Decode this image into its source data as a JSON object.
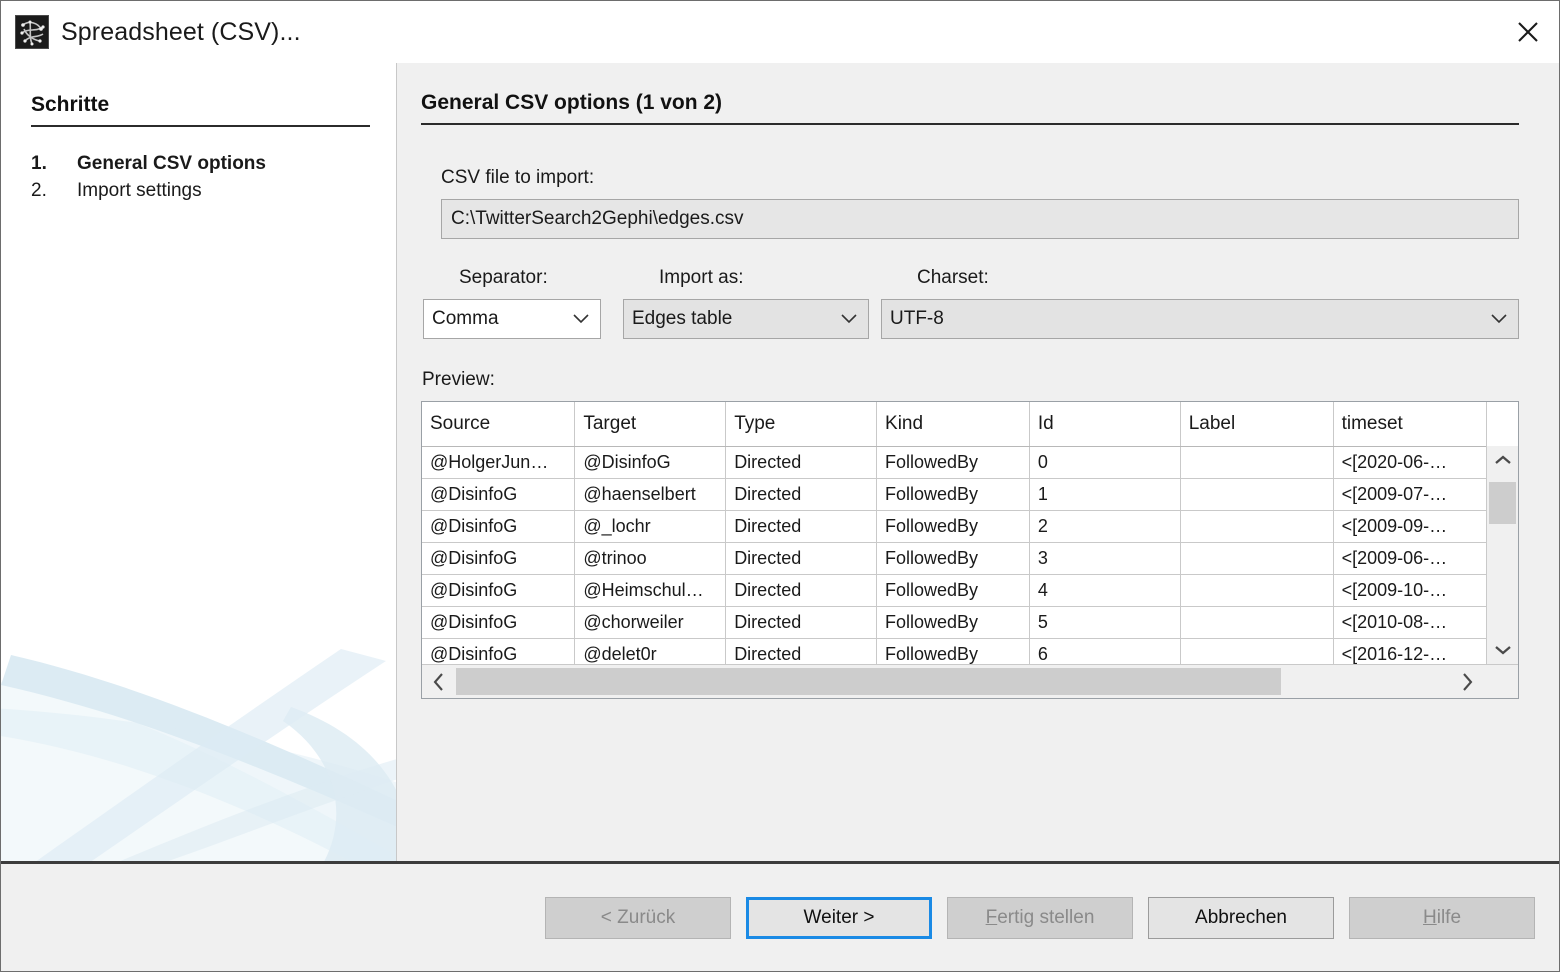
{
  "window": {
    "title": "Spreadsheet (CSV)...",
    "icon": "gephi-graph-icon",
    "close_label": "close-icon"
  },
  "sidebar": {
    "heading": "Schritte",
    "steps": [
      {
        "num": "1.",
        "label": "General CSV options",
        "current": true
      },
      {
        "num": "2.",
        "label": "Import settings",
        "current": false
      }
    ]
  },
  "main": {
    "title": "General CSV options (1 von 2)",
    "file_label": "CSV file to import:",
    "file_path": "C:\\TwitterSearch2Gephi\\edges.csv",
    "separator_label": "Separator:",
    "separator_value": "Comma",
    "import_as_label": "Import as:",
    "import_as_value": "Edges table",
    "charset_label": "Charset:",
    "charset_value": "UTF-8",
    "preview_label": "Preview:"
  },
  "preview_table": {
    "columns": [
      "Source",
      "Target",
      "Type",
      "Kind",
      "Id",
      "Label",
      "timeset"
    ],
    "rows": [
      [
        "@HolgerJun…",
        "@DisinfoG",
        "Directed",
        "FollowedBy",
        "0",
        "",
        "<[2020-06-…"
      ],
      [
        "@DisinfoG",
        "@haenselbert",
        "Directed",
        "FollowedBy",
        "1",
        "",
        "<[2009-07-…"
      ],
      [
        "@DisinfoG",
        "@_lochr",
        "Directed",
        "FollowedBy",
        "2",
        "",
        "<[2009-09-…"
      ],
      [
        "@DisinfoG",
        "@trinoo",
        "Directed",
        "FollowedBy",
        "3",
        "",
        "<[2009-06-…"
      ],
      [
        "@DisinfoG",
        "@Heimschul…",
        "Directed",
        "FollowedBy",
        "4",
        "",
        "<[2009-10-…"
      ],
      [
        "@DisinfoG",
        "@chorweiler",
        "Directed",
        "FollowedBy",
        "5",
        "",
        "<[2010-08-…"
      ],
      [
        "@DisinfoG",
        "@delet0r",
        "Directed",
        "FollowedBy",
        "6",
        "",
        "<[2016-12-…"
      ]
    ]
  },
  "footer": {
    "back": {
      "label": "< Zurück",
      "state": "disabled"
    },
    "next": {
      "label": "Weiter >",
      "state": "focused"
    },
    "finish": {
      "label": "Fertig stellen",
      "state": "disabled",
      "mnemonic": "F"
    },
    "cancel": {
      "label": "Abbrechen",
      "state": "enabled"
    },
    "help": {
      "label": "Hilfe",
      "state": "disabled",
      "mnemonic": "H"
    }
  },
  "colors": {
    "focus_blue": "#1a8ae5",
    "panel_gray": "#f0f0f0",
    "watermark_blue": "#cfe4ef"
  }
}
